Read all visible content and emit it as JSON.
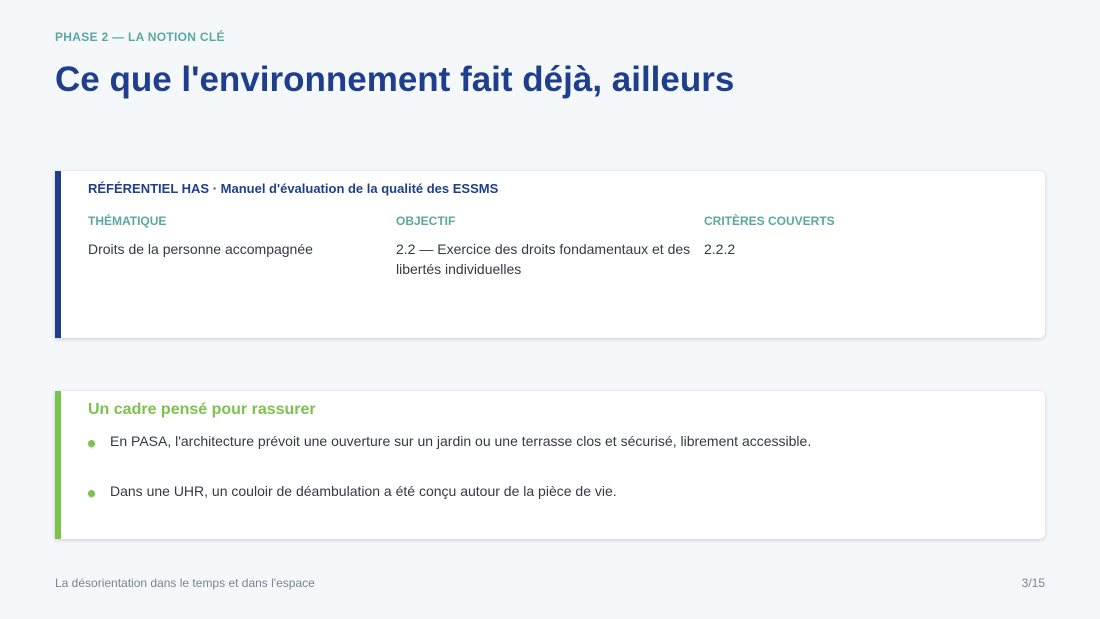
{
  "header": {
    "eyebrow": "PHASE 2 — LA NOTION CLÉ",
    "title": "Ce que l'environnement fait déjà, ailleurs"
  },
  "referentiel": {
    "heading": "RÉFÉRENTIEL HAS · Manuel d'évaluation de la qualité des ESSMS",
    "columns": [
      {
        "label": "THÉMATIQUE",
        "value": "Droits de la personne accompagnée"
      },
      {
        "label": "OBJECTIF",
        "value": "2.2 — Exercice des droits fondamentaux et des libertés individuelles"
      },
      {
        "label": "CRITÈRES COUVERTS",
        "value": "2.2.2"
      }
    ]
  },
  "cadre": {
    "title": "Un cadre pensé pour rassurer",
    "items": [
      "En PASA, l'architecture prévoit une ouverture sur un jardin ou une terrasse clos et sécurisé, librement accessible.",
      "Dans une UHR, un couloir de déambulation a été conçu autour de la pièce de vie."
    ]
  },
  "footer": {
    "text": "La désorientation dans le temps et dans l'espace",
    "page": "3/15"
  },
  "colors": {
    "accent_blue": "#1f3f8c",
    "accent_teal": "#5aa8a0",
    "accent_green": "#7cc24e"
  }
}
